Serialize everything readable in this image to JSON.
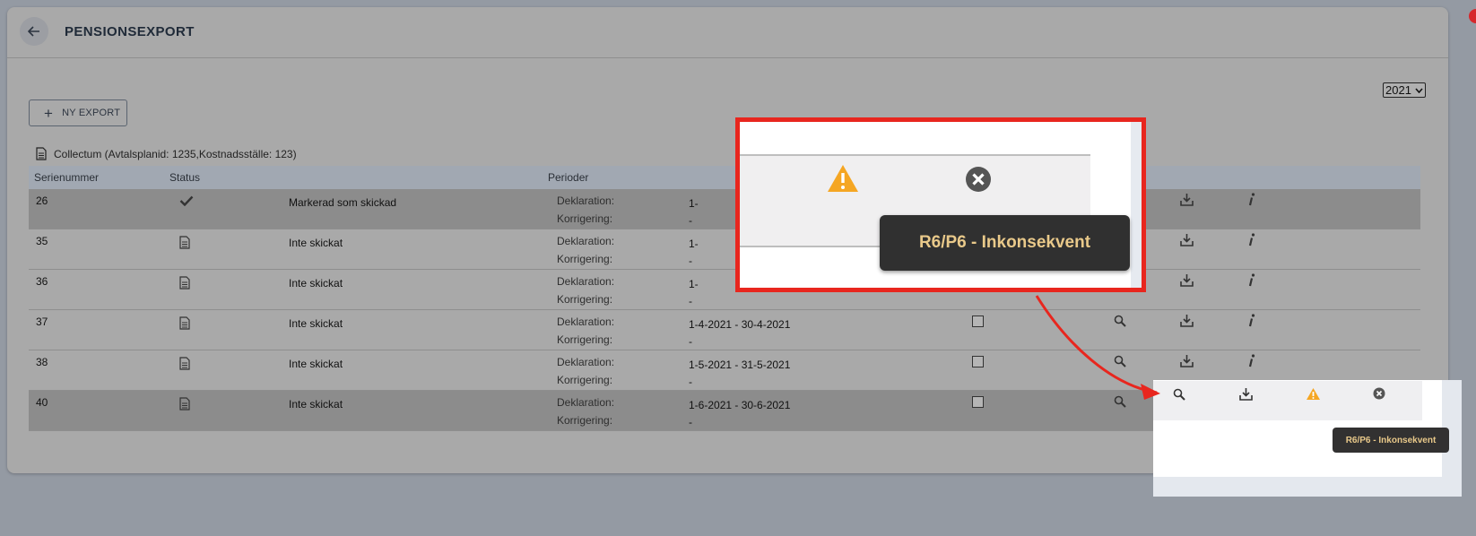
{
  "header": {
    "title": "PENSIONSEXPORT"
  },
  "year_select": {
    "value": "2021"
  },
  "new_export_button": {
    "label": "NY EXPORT"
  },
  "provider": {
    "label": "Collectum (Avtalsplanid: 1235,Kostnadsställe: 123)"
  },
  "table": {
    "columns": {
      "serial": "Serienummer",
      "status": "Status",
      "periods": "Perioder"
    },
    "period_labels": {
      "declaration": "Deklaration:",
      "correction": "Korrigering:"
    },
    "rows": [
      {
        "serial": "26",
        "status_icon": "check-icon",
        "status_text": "Markerad som skickad",
        "declaration": "1-",
        "correction": "-"
      },
      {
        "serial": "35",
        "status_icon": "document-icon",
        "status_text": "Inte skickat",
        "declaration": "1-",
        "correction": "-"
      },
      {
        "serial": "36",
        "status_icon": "document-icon",
        "status_text": "Inte skickat",
        "declaration": "1-",
        "correction": "-"
      },
      {
        "serial": "37",
        "status_icon": "document-icon",
        "status_text": "Inte skickat",
        "declaration": "1-4-2021 - 30-4-2021",
        "correction": "-"
      },
      {
        "serial": "38",
        "status_icon": "document-icon",
        "status_text": "Inte skickat",
        "declaration": "1-5-2021 - 31-5-2021",
        "correction": "-"
      },
      {
        "serial": "40",
        "status_icon": "document-icon",
        "status_text": "Inte skickat",
        "declaration": "1-6-2021 - 30-6-2021",
        "correction": "-"
      }
    ]
  },
  "tooltip": {
    "text": "R6/P6 - Inkonsekvent"
  },
  "colors": {
    "warning": "#f5a623",
    "highlight_border": "#e8261e",
    "tooltip_text": "#e9c98a"
  }
}
